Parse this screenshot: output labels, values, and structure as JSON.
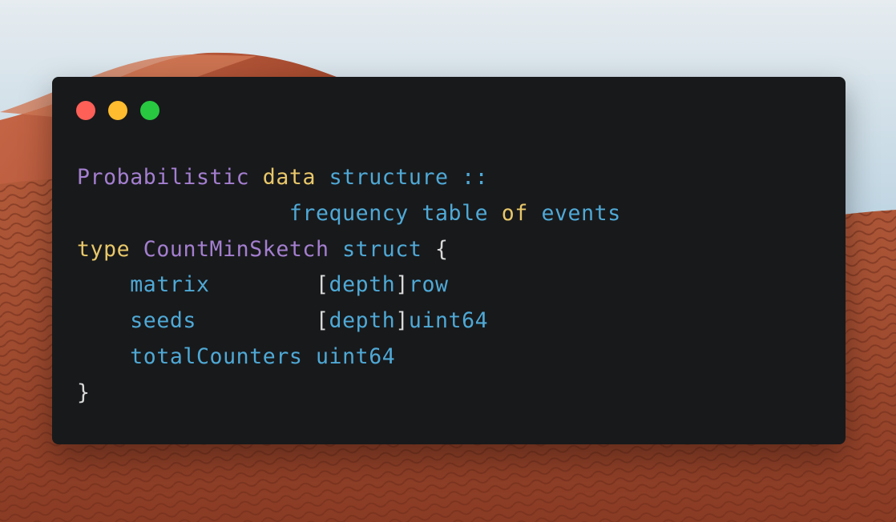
{
  "colors": {
    "window_bg": "#18191b",
    "purple": "#a47fd0",
    "yellow": "#e9c86a",
    "blue": "#4fa9d6",
    "plain": "#d9d9d9",
    "close": "#fe5f57",
    "minimize": "#febc2e",
    "maximize": "#28c840"
  },
  "window_controls": {
    "close": "close-dot",
    "minimize": "minimize-dot",
    "maximize": "maximize-dot"
  },
  "code": {
    "lines": [
      [
        {
          "text": "Probabilistic",
          "color": "purple"
        },
        {
          "text": " ",
          "color": "plain"
        },
        {
          "text": "data",
          "color": "yellow"
        },
        {
          "text": " ",
          "color": "plain"
        },
        {
          "text": "structure ::",
          "color": "blue"
        }
      ],
      [
        {
          "text": "                ",
          "color": "plain"
        },
        {
          "text": "frequency table",
          "color": "blue"
        },
        {
          "text": " ",
          "color": "plain"
        },
        {
          "text": "of",
          "color": "yellow"
        },
        {
          "text": " ",
          "color": "plain"
        },
        {
          "text": "events",
          "color": "blue"
        }
      ],
      [
        {
          "text": "type",
          "color": "yellow"
        },
        {
          "text": " ",
          "color": "plain"
        },
        {
          "text": "CountMinSketch",
          "color": "purple"
        },
        {
          "text": " ",
          "color": "plain"
        },
        {
          "text": "struct",
          "color": "blue"
        },
        {
          "text": " {",
          "color": "plain"
        }
      ],
      [
        {
          "text": "    ",
          "color": "plain"
        },
        {
          "text": "matrix",
          "color": "blue"
        },
        {
          "text": "        [",
          "color": "plain"
        },
        {
          "text": "depth",
          "color": "blue"
        },
        {
          "text": "]",
          "color": "plain"
        },
        {
          "text": "row",
          "color": "blue"
        }
      ],
      [
        {
          "text": "    ",
          "color": "plain"
        },
        {
          "text": "seeds",
          "color": "blue"
        },
        {
          "text": "         [",
          "color": "plain"
        },
        {
          "text": "depth",
          "color": "blue"
        },
        {
          "text": "]",
          "color": "plain"
        },
        {
          "text": "uint64",
          "color": "blue"
        }
      ],
      [
        {
          "text": "    ",
          "color": "plain"
        },
        {
          "text": "totalCounters",
          "color": "blue"
        },
        {
          "text": " ",
          "color": "plain"
        },
        {
          "text": "uint64",
          "color": "blue"
        }
      ],
      [
        {
          "text": "}",
          "color": "plain"
        }
      ]
    ]
  }
}
